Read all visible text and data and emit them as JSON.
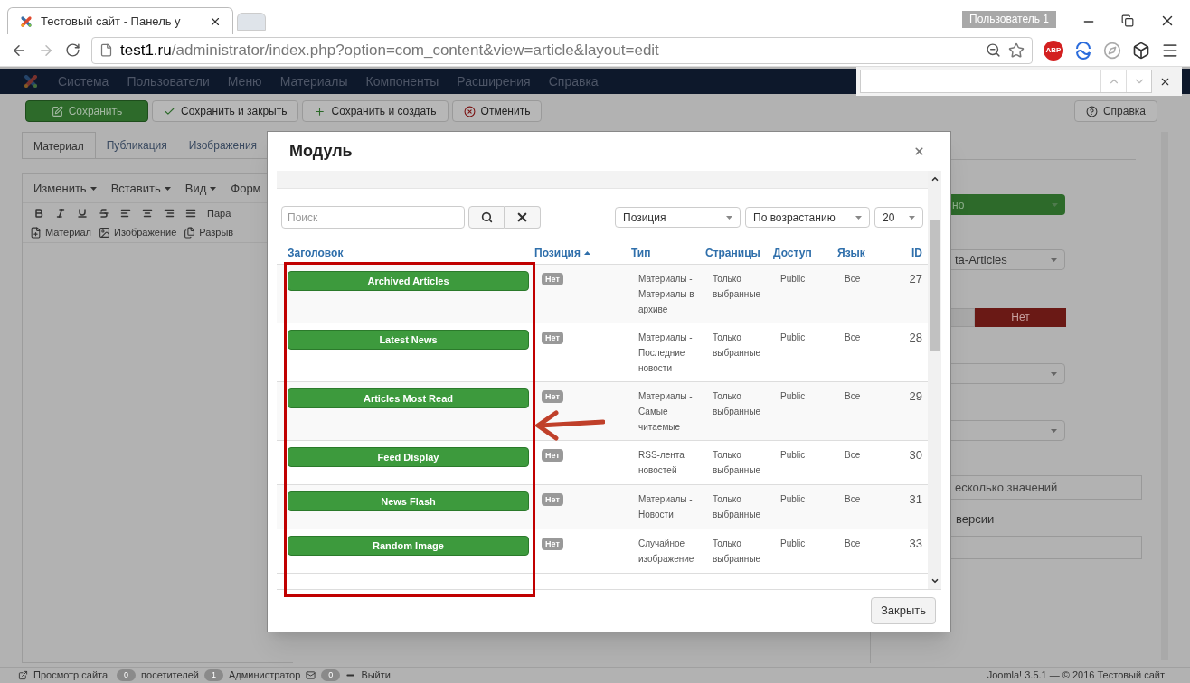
{
  "browser": {
    "tabs": [
      {
        "title": "Тестовый сайт - Панель у",
        "selected": true
      }
    ],
    "profile": "Пользователь 1",
    "url": {
      "host": "test1.ru",
      "path": "/administrator/index.php?option=com_content&view=article&layout=edit"
    },
    "abp": "ABP"
  },
  "admin_menu": [
    "Система",
    "Пользователи",
    "Меню",
    "Материалы",
    "Компоненты",
    "Расширения",
    "Справка"
  ],
  "toolbar": {
    "buttons": [
      {
        "label": "Сохранить",
        "kind": "save"
      },
      {
        "label": "Сохранить и закрыть",
        "kind": "save-close"
      },
      {
        "label": "Сохранить и создать",
        "kind": "save-new"
      },
      {
        "label": "Отменить",
        "kind": "cancel"
      }
    ],
    "help": "Справка"
  },
  "editor": {
    "tabs": [
      {
        "label": "Материал",
        "selected": true
      },
      {
        "label": "Публикация",
        "selected": false
      },
      {
        "label": "Изображения",
        "selected": false
      }
    ],
    "menu": [
      "Изменить",
      "Вставить",
      "Вид",
      "Форм"
    ],
    "paragraph": "Пара",
    "insert_buttons": [
      {
        "label": "Материал",
        "kind": "article"
      },
      {
        "label": "Изображение",
        "kind": "image"
      },
      {
        "label": "Разрыв",
        "kind": "pagebreak"
      }
    ]
  },
  "right_panel": {
    "status": "но",
    "category": "ta-Articles",
    "toggle": {
      "label": "Нет",
      "selected": true
    },
    "tags_placeholder": "есколько значений",
    "version_label": "версии"
  },
  "modal": {
    "title": "Модуль",
    "search_placeholder": "Поиск",
    "selects": [
      "Позиция",
      "По возрастанию",
      "20"
    ],
    "columns": [
      {
        "label": "Заголовок",
        "sorted": false
      },
      {
        "label": "Позиция",
        "sorted": true
      },
      {
        "label": "Тип",
        "sorted": false
      },
      {
        "label": "Страницы",
        "sorted": false
      },
      {
        "label": "Доступ",
        "sorted": false
      },
      {
        "label": "Язык",
        "sorted": false
      },
      {
        "label": "ID",
        "sorted": false
      }
    ],
    "rows": [
      {
        "title": "Archived Articles",
        "position": "Нет",
        "type": "Материалы - Материалы в архиве",
        "pages": "Только выбранные",
        "access": "Public",
        "language": "Все",
        "id": "27"
      },
      {
        "title": "Latest News",
        "position": "Нет",
        "type": "Материалы - Последние новости",
        "pages": "Только выбранные",
        "access": "Public",
        "language": "Все",
        "id": "28"
      },
      {
        "title": "Articles Most Read",
        "position": "Нет",
        "type": "Материалы - Самые читаемые",
        "pages": "Только выбранные",
        "access": "Public",
        "language": "Все",
        "id": "29"
      },
      {
        "title": "Feed Display",
        "position": "Нет",
        "type": "RSS-лента новостей",
        "pages": "Только выбранные",
        "access": "Public",
        "language": "Все",
        "id": "30"
      },
      {
        "title": "News Flash",
        "position": "Нет",
        "type": "Материалы - Новости",
        "pages": "Только выбранные",
        "access": "Public",
        "language": "Все",
        "id": "31"
      },
      {
        "title": "Random Image",
        "position": "Нет",
        "type": "Случайное изображение",
        "pages": "Только выбранные",
        "access": "Public",
        "language": "Все",
        "id": "33"
      }
    ],
    "close_button": "Закрыть"
  },
  "status_bar": {
    "preview": "Просмотр сайта",
    "visitors_count": "0",
    "visitors": "посетителей",
    "admins_count": "1",
    "admins": "Администратор",
    "messages_count": "0",
    "logout": "Выйти",
    "footer": "Joomla! 3.5.1 — © 2016 Тестовый сайт"
  }
}
